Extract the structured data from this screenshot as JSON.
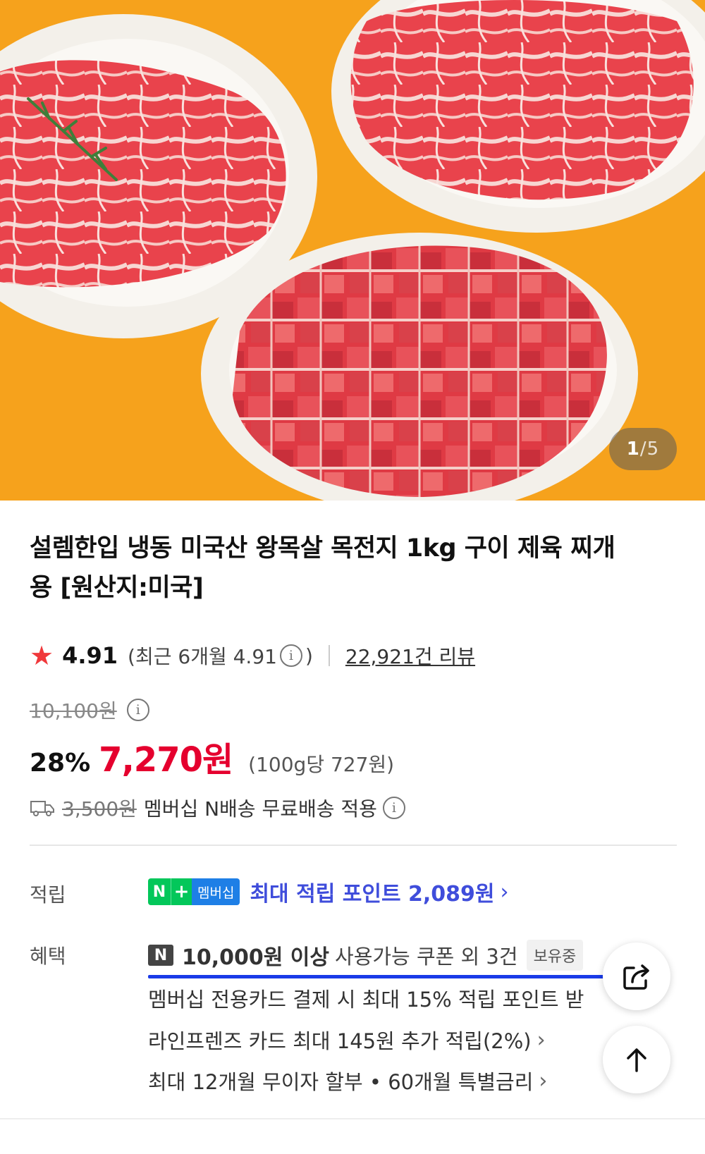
{
  "gallery": {
    "current": "1",
    "separator": "/",
    "total": "5"
  },
  "product": {
    "title": "설렘한입 냉동 미국산 왕목살 목전지 1kg 구이 제육 찌개용 [원산지:미국]",
    "rating": "4.91",
    "rating_recent": "(최근 6개월 4.91",
    "rating_recent_close": ")",
    "review_count": "22,921건 리뷰",
    "original_price": "10,100원",
    "discount": "28%",
    "price": "7,270원",
    "unit_price": "(100g당 727원)",
    "shipping_fee": "3,500원",
    "shipping_text": "멤버십 N배송 무료배송 적용"
  },
  "benefits": {
    "point_label": "적립",
    "point_badge_n": "N",
    "point_badge_plus": "+",
    "point_badge_membership": "멤버십",
    "point_text": "최대 적립 포인트 2,089원",
    "benefit_label": "혜택",
    "coupon_badge": "N",
    "coupon_strong": "10,000원 이상",
    "coupon_rest": "사용가능 쿠폰 외 3건",
    "coupon_hold": "보유중",
    "card_text": "멤버십 전용카드 결제 시 최대 15% 적립 포인트 받",
    "linefriends_text": "라인프렌즈 카드 최대 145원 추가 적립(2%)",
    "installment_text": "최대 12개월 무이자 할부 • 60개월 특별금리"
  },
  "icons": {
    "star": "star-icon",
    "info": "info-icon",
    "truck": "truck-icon",
    "chevron": "chevron-right-icon",
    "share": "share-icon",
    "top": "arrow-up-icon"
  },
  "colors": {
    "price_red": "#e5002e",
    "star_red": "#f0383b",
    "point_blue": "#3f4ddb",
    "naver_green": "#03c75a",
    "hero_orange": "#f6a21c"
  }
}
